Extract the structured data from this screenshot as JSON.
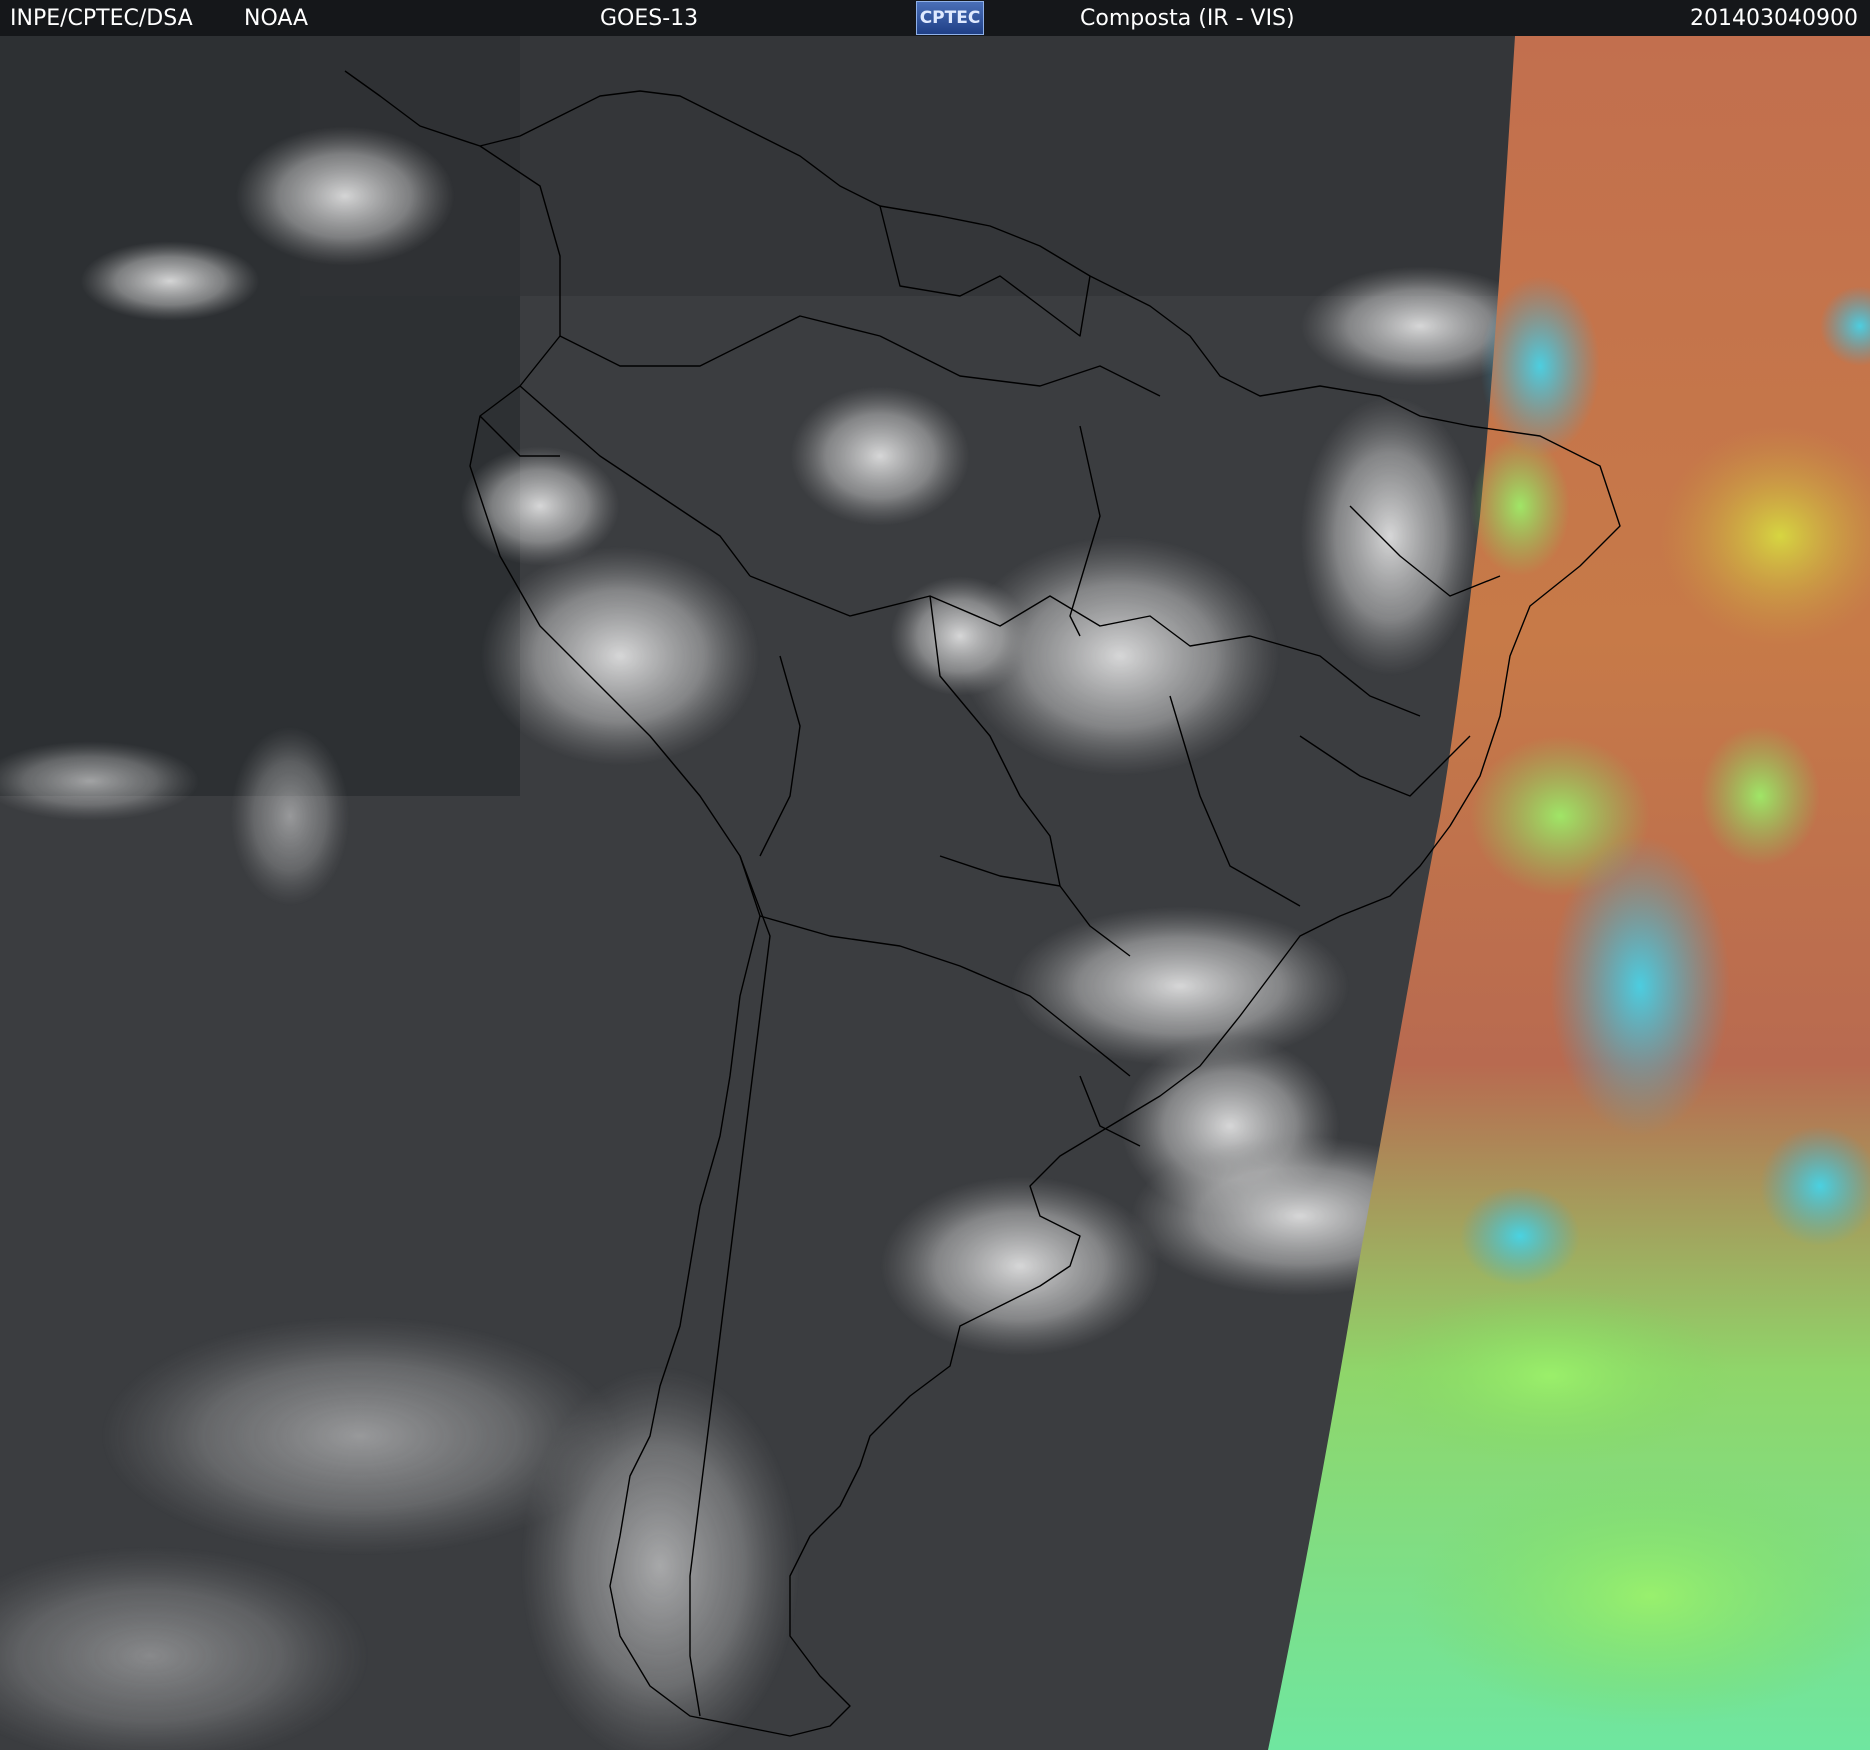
{
  "header": {
    "source": "INPE/CPTEC/DSA",
    "agency": "NOAA",
    "satellite": "GOES-13",
    "logo_text": "CPTEC",
    "product": "Composta (IR - VIS)",
    "timestamp": "201403040900"
  },
  "colors": {
    "header_bg": "#15171a",
    "ir_background": "#3a3c3f",
    "ocean_dark": "#2a2c2f",
    "vis_orange": "#c0704c",
    "vis_green": "#79e860",
    "vis_cyan": "#35c8e8",
    "cloud_white": "#e8e8e8",
    "border_lines": "#000000"
  }
}
